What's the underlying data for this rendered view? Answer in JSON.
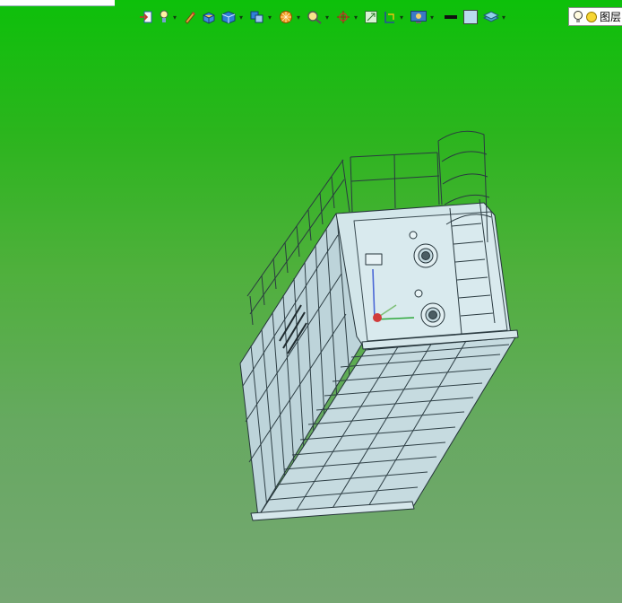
{
  "window": {
    "title_strip": ""
  },
  "toolbar": {
    "buttons": [
      {
        "icon": "exit-sketch-icon",
        "has_dropdown": false
      },
      {
        "icon": "light-source-icon",
        "has_dropdown": true
      },
      {
        "icon": "pencil-icon",
        "has_dropdown": false
      },
      {
        "icon": "shaded-box-icon",
        "has_dropdown": false
      },
      {
        "icon": "view-cube-icon",
        "has_dropdown": true
      },
      {
        "icon": "render-mode-icon",
        "has_dropdown": true
      },
      {
        "icon": "orange-wheel-icon",
        "has_dropdown": true
      },
      {
        "icon": "zoom-magnifier-icon",
        "has_dropdown": true
      },
      {
        "icon": "pan-rotate-icon",
        "has_dropdown": true
      },
      {
        "icon": "fit-view-icon",
        "has_dropdown": false
      },
      {
        "icon": "section-plane-icon",
        "has_dropdown": true
      },
      {
        "icon": "display-monitor-icon",
        "has_dropdown": true
      },
      {
        "icon": "line-style-icon",
        "has_dropdown": false
      },
      {
        "icon": "background-color-icon",
        "has_dropdown": false
      },
      {
        "icon": "layer-stack-icon",
        "has_dropdown": true
      }
    ],
    "layer_label": "图层"
  },
  "colors": {
    "background_top": "#0dc00a",
    "background_bottom": "#76a773",
    "model_fill": "#c8dde2",
    "model_line": "#25343a"
  },
  "viewport": {
    "model": "steel-tank-with-ladder-and-railing"
  }
}
